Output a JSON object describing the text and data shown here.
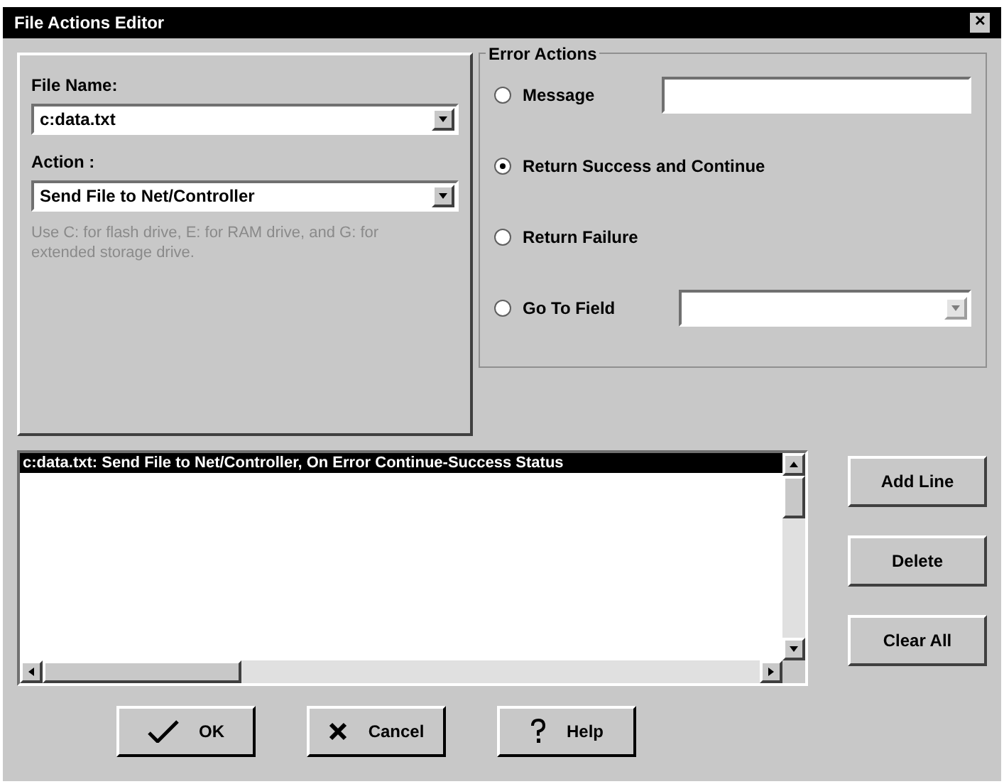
{
  "window": {
    "title": "File Actions Editor",
    "close": "✕"
  },
  "file_name": {
    "label": "File Name:",
    "value": "c:data.txt"
  },
  "action": {
    "label": "Action :",
    "value": "Send File to Net/Controller"
  },
  "hint": "Use C: for flash drive, E: for RAM drive, and G: for extended storage drive.",
  "error_actions": {
    "title": "Error Actions",
    "options": [
      {
        "label": "Message",
        "selected": false,
        "kind": "text"
      },
      {
        "label": "Return Success and Continue",
        "selected": true,
        "kind": "plain"
      },
      {
        "label": "Return Failure",
        "selected": false,
        "kind": "plain"
      },
      {
        "label": "Go To Field",
        "selected": false,
        "kind": "dropdown"
      }
    ]
  },
  "lines": [
    {
      "text": "c:data.txt: Send File to Net/Controller, On Error Continue-Success Status",
      "selected": true
    }
  ],
  "side_buttons": [
    "Add Line",
    "Delete",
    "Clear All"
  ],
  "buttons": [
    {
      "kind": "ok",
      "label": "OK"
    },
    {
      "kind": "cancel",
      "label": "Cancel"
    },
    {
      "kind": "help",
      "label": "Help"
    }
  ]
}
